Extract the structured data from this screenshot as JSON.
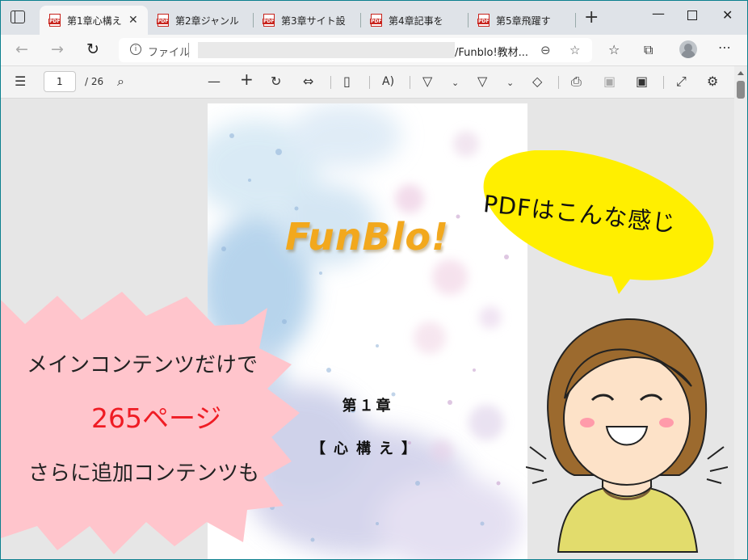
{
  "tabs": [
    {
      "label": "第1章心構え",
      "active": true
    },
    {
      "label": "第2章ジャンル",
      "active": false
    },
    {
      "label": "第3章サイト設",
      "active": false
    },
    {
      "label": "第4章記事を",
      "active": false
    },
    {
      "label": "第5章飛躍す",
      "active": false
    }
  ],
  "address": {
    "scheme_label": "ファイル",
    "url_tail": "/Funblo!教材..."
  },
  "pdf_toolbar": {
    "page_number": "1",
    "page_total": "/ 26"
  },
  "pdf_page": {
    "title": "FunBlo!",
    "chapter_number": "第１章",
    "chapter_name": "【心構え】"
  },
  "callouts": {
    "burst_line1": "メインコンテンツだけで",
    "burst_line2": "265ページ",
    "burst_line3": "さらに追加コンテンツも",
    "speech_bubble": "PDFはこんな感じ"
  },
  "icons": [
    "tab-actions-icon",
    "pdf-file-icon",
    "close-icon",
    "new-tab-icon",
    "minimize-icon",
    "maximize-icon",
    "window-close-icon",
    "back-icon",
    "forward-icon",
    "refresh-icon",
    "info-icon",
    "zoom-icon",
    "add-favorite-icon",
    "favorites-icon",
    "collections-icon",
    "profile-icon",
    "more-icon",
    "contents-icon",
    "search-icon",
    "zoom-out-icon",
    "zoom-in-icon",
    "rotate-icon",
    "fit-width-icon",
    "page-view-icon",
    "read-aloud-icon",
    "draw-icon",
    "highlight-icon",
    "eraser-icon",
    "print-icon",
    "save-icon",
    "save-as-icon",
    "fullscreen-icon",
    "settings-icon"
  ],
  "colors": {
    "accent_title": "#f2a81d",
    "highlight_red": "#ef1c24",
    "burst_pink": "#ffc5cc",
    "bubble_yellow": "#ffef00"
  }
}
